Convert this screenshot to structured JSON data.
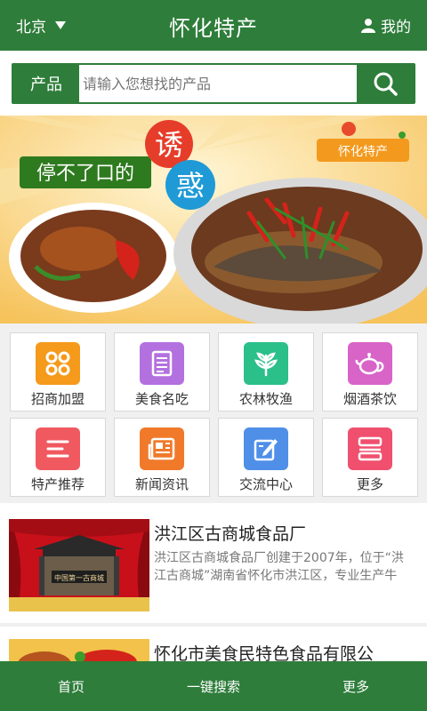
{
  "header": {
    "city": "北京",
    "title": "怀化特产",
    "user_label": "我的"
  },
  "search": {
    "category": "产品",
    "placeholder": "请输入您想找的产品"
  },
  "banner": {
    "slogan": "停不了口的",
    "big1": "诱",
    "big2": "惑",
    "tag": "怀化特产"
  },
  "categories": [
    {
      "label": "招商加盟",
      "icon": "clover-icon",
      "color": "#f59a1b"
    },
    {
      "label": "美食名吃",
      "icon": "document-icon",
      "color": "#b371e0"
    },
    {
      "label": "农林牧渔",
      "icon": "leaf-icon",
      "color": "#2bbf8a"
    },
    {
      "label": "烟酒茶饮",
      "icon": "teapot-icon",
      "color": "#d864c8"
    },
    {
      "label": "特产推荐",
      "icon": "lines-icon",
      "color": "#f0595f"
    },
    {
      "label": "新闻资讯",
      "icon": "newspaper-icon",
      "color": "#f07a2a"
    },
    {
      "label": "交流中心",
      "icon": "edit-icon",
      "color": "#4f8fe8"
    },
    {
      "label": "更多",
      "icon": "stack-icon",
      "color": "#f0506e"
    }
  ],
  "listings": [
    {
      "title": "洪江区古商城食品厂",
      "desc": "洪江区古商城食品厂创建于2007年，位于“洪江古商城”湖南省怀化市洪江区，专业生产牛",
      "sign": "中国第一古商城"
    },
    {
      "title": "怀化市美食民特色食品有限公",
      "desc": ""
    }
  ],
  "bottom_nav": {
    "home": "首页",
    "search": "一键搜索",
    "more": "更多"
  }
}
